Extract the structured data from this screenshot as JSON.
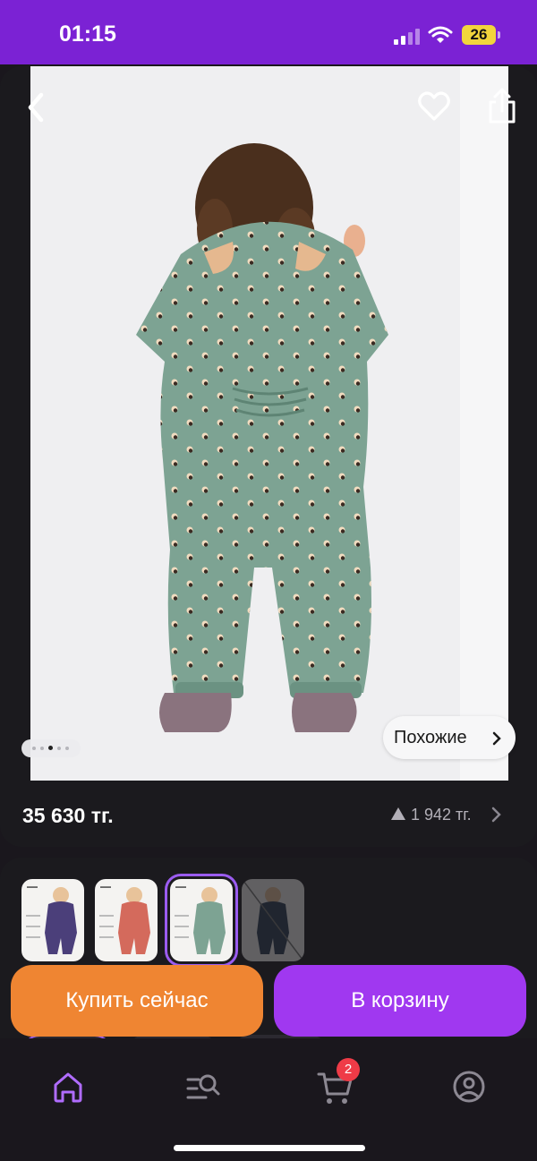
{
  "status_bar": {
    "time": "01:15",
    "battery": "26",
    "icons": [
      "signal-icon",
      "wifi-icon",
      "battery-icon"
    ]
  },
  "product": {
    "price": "35 630 тг.",
    "bonus": "1 942 тг.",
    "similar_label": "Похожие",
    "gallery": {
      "total_photos": 5,
      "current_photo": 3
    },
    "photo_description": "child in green printed winter jumpsuit with ears, back view"
  },
  "variants": [
    {
      "color": "purple",
      "selected": false,
      "available": true
    },
    {
      "color": "coral",
      "selected": false,
      "available": true
    },
    {
      "color": "green",
      "selected": true,
      "available": true
    },
    {
      "color": "navy",
      "selected": false,
      "available": false
    }
  ],
  "actions": {
    "buy_now": "Купить сейчас",
    "add_to_cart": "В корзину"
  },
  "tab_bar": {
    "items": [
      "home-icon",
      "catalog-search-icon",
      "cart-icon",
      "profile-icon"
    ],
    "active": "home-icon",
    "cart_badge": "2"
  },
  "colors": {
    "status_bar": "#7b22d4",
    "buy_now": "#ef8532",
    "add_to_cart": "#a038f0",
    "accent": "#9b5cf0",
    "badge": "#ef3b47"
  }
}
